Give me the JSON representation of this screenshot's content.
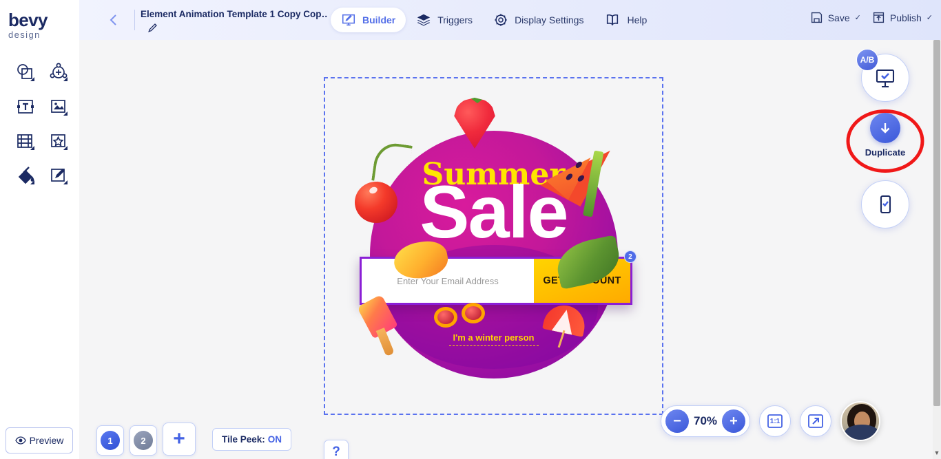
{
  "brand": {
    "name": "bevy",
    "subtitle": "design"
  },
  "left_tools": [
    {
      "name": "shapes-tool",
      "label": "Shapes"
    },
    {
      "name": "add-element-tool",
      "label": "Add Element"
    },
    {
      "name": "text-tool",
      "label": "Text"
    },
    {
      "name": "image-tool",
      "label": "Image"
    },
    {
      "name": "video-tool",
      "label": "Video"
    },
    {
      "name": "icon-tool",
      "label": "Icon"
    },
    {
      "name": "fill-tool",
      "label": "Fill"
    },
    {
      "name": "draw-tool",
      "label": "Draw"
    }
  ],
  "preview": {
    "label": "Preview",
    "icon": "eye-icon"
  },
  "header": {
    "back_icon": "chevron-left-icon",
    "document_title": "Element Animation Template 1 Copy Cop…",
    "edit_icon": "pencil-icon",
    "nav": [
      {
        "label": "Builder",
        "icon": "monitor-pencil-icon",
        "active": true
      },
      {
        "label": "Triggers",
        "icon": "layers-icon",
        "active": false
      },
      {
        "label": "Display Settings",
        "icon": "gear-icon",
        "active": false
      },
      {
        "label": "Help",
        "icon": "book-icon",
        "active": false
      }
    ],
    "actions": [
      {
        "label": "Save",
        "icon": "floppy-icon",
        "chevron": "✓"
      },
      {
        "label": "Publish",
        "icon": "upload-icon",
        "chevron": "✓"
      }
    ]
  },
  "creative": {
    "title_top": "Summer",
    "title_main": "Sale",
    "email_placeholder": "Enter Your Email Address",
    "email_value": "",
    "cta_label": "GET DISCOUNT",
    "cta_badge": "2",
    "dismiss_label": "I'm a winter person"
  },
  "right_panel": {
    "ab_badge": "A/B",
    "desktop_button": "desktop-check-icon",
    "duplicate": {
      "label": "Duplicate",
      "icon": "arrow-down-icon",
      "highlighted": true
    },
    "mobile_button": "mobile-check-icon",
    "highlight_color": "#f01818"
  },
  "zoom": {
    "minus": "−",
    "value": "70%",
    "plus": "+",
    "one_to_one": "1:1",
    "fit_icon": "expand-arrow-icon"
  },
  "bottom": {
    "tiles": [
      {
        "label": "1",
        "active": true
      },
      {
        "label": "2",
        "active": false
      }
    ],
    "add_tile": "+",
    "tile_peek_label": "Tile Peek:",
    "tile_peek_value": "ON",
    "help_label": "?"
  },
  "colors": {
    "accent_blue": "#4462e4",
    "header_bg": "#e7ebfc",
    "canvas_bg": "#f5f5f6",
    "selection_border": "#5a72ef",
    "cta_yellow": "#ffd400",
    "creative_purple": "#8b1fd6",
    "title_yellow": "#ffe500"
  }
}
